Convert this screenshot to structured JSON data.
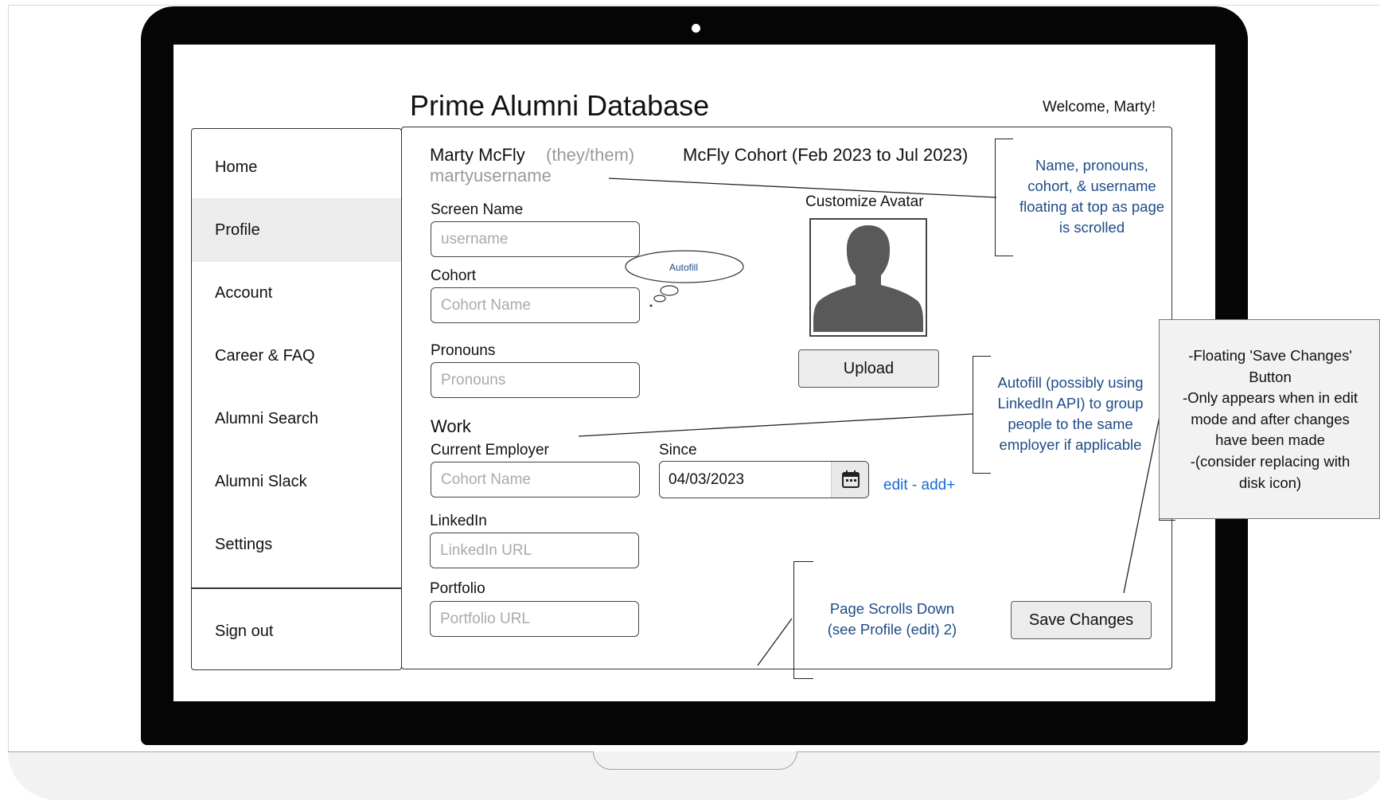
{
  "app": {
    "title": "Prime Alumni Database",
    "welcome": "Welcome, Marty!"
  },
  "sidebar": {
    "items": [
      {
        "label": "Home",
        "active": false
      },
      {
        "label": "Profile",
        "active": true
      },
      {
        "label": "Account",
        "active": false
      },
      {
        "label": "Career & FAQ",
        "active": false
      },
      {
        "label": "Alumni Search",
        "active": false
      },
      {
        "label": "Alumni Slack",
        "active": false
      },
      {
        "label": "Settings",
        "active": false
      }
    ],
    "signout": "Sign out"
  },
  "profile": {
    "name": "Marty McFly",
    "pronouns": "(they/them)",
    "username": "martyusername",
    "cohort_heading": "McFly Cohort (Feb 2023 to Jul 2023)"
  },
  "form": {
    "screen_name": {
      "label": "Screen Name",
      "placeholder": "username"
    },
    "cohort": {
      "label": "Cohort",
      "placeholder": "Cohort Name"
    },
    "pronouns": {
      "label": "Pronouns",
      "placeholder": "Pronouns"
    },
    "work_heading": "Work",
    "employer": {
      "label": "Current Employer",
      "placeholder": "Cohort Name"
    },
    "since": {
      "label": "Since",
      "value": "04/03/2023"
    },
    "edit_add": "edit - add+",
    "linkedin": {
      "label": "LinkedIn",
      "placeholder": "LinkedIn URL"
    },
    "portfolio": {
      "label": "Portfolio",
      "placeholder": "Portfolio URL"
    }
  },
  "avatar": {
    "label": "Customize Avatar",
    "upload": "Upload"
  },
  "save_button": "Save Changes",
  "annotations": {
    "autofill_bubble": "Autofill",
    "header_note": [
      "Name, pronouns,",
      "cohort, & username",
      "floating at top as page",
      "is scrolled"
    ],
    "autofill_note": [
      "Autofill (possibly using",
      "LinkedIn API) to group",
      "people to the same",
      "employer if applicable"
    ],
    "scroll_note": [
      "Page Scrolls Down",
      "(see Profile (edit) 2)"
    ],
    "save_note": [
      "-Floating 'Save Changes'",
      "Button",
      "-Only appears when in edit",
      "mode and after changes",
      "have been made",
      "-(consider replacing with",
      "disk icon)"
    ]
  },
  "colors": {
    "annotation_blue": "#1e4b87",
    "link_blue": "#1a6ad6",
    "placeholder_gray": "#aaaaaa",
    "active_nav": "#ececec"
  },
  "icons": {
    "calendar": "calendar-icon",
    "avatar": "person-silhouette-icon"
  }
}
